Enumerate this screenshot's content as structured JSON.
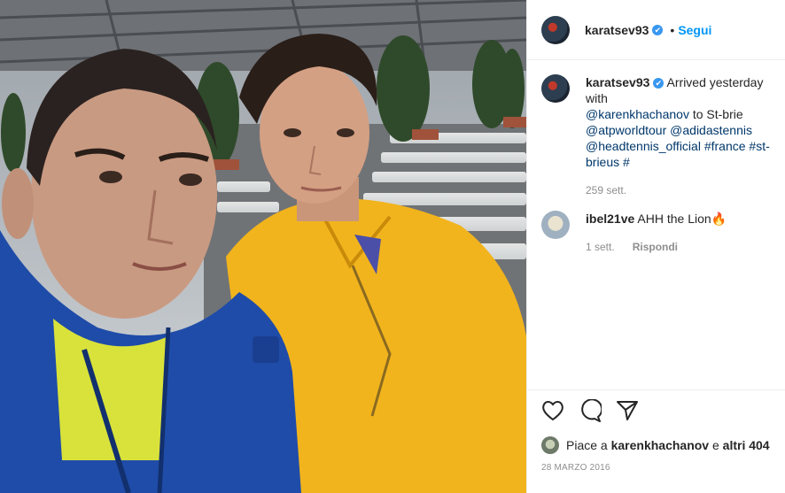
{
  "post": {
    "username": "karatsev93",
    "verified_mark": "✔",
    "separator": "•",
    "follow_label": "Segui",
    "photo_desc_icon": "selfie-photo"
  },
  "caption": {
    "username": "karatsev93",
    "text_start": "Arrived yesterday with",
    "mention1": "@karenkhachanov",
    "text_mid": " to St-brie",
    "mention2": "@atpworldtour",
    "mention3": "@adidastennis",
    "mention4": "@headtennis_official",
    "tag1": "#france",
    "tag2": "#st-brieus",
    "tag3": "#",
    "time": "259 sett."
  },
  "comment": {
    "username": "ibel21ve",
    "text": "AHH the Lion",
    "emoji": "🔥",
    "time": "1 sett.",
    "reply_label": "Rispondi"
  },
  "likes": {
    "prefix": "Piace a",
    "user": "karenkhachanov",
    "conj": "e",
    "others": "altri 404"
  },
  "date": "28 MARZO 2016",
  "icons": {
    "like": "heart-icon",
    "comment": "comment-icon",
    "share": "share-icon"
  }
}
